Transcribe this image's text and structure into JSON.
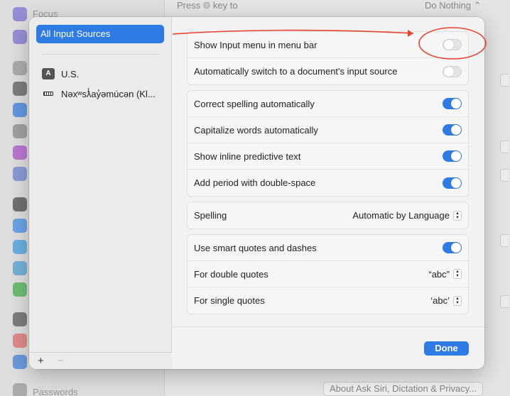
{
  "background": {
    "sidebar_top_label": "Focus",
    "sidebar_bottom_label": "Passwords",
    "press_key_text": "Press",
    "press_key_suffix": "key to",
    "do_nothing_value": "Do Nothing",
    "about_button_label": "About Ask Siri, Dictation & Privacy..."
  },
  "sheet": {
    "sidebar": {
      "selected_label": "All Input Sources",
      "sources": [
        {
          "label": "U.S.",
          "badge": "A",
          "icon": "letter-a-icon"
        },
        {
          "label": "Nəxʷsƛ̓ay̓əmúcən (Kl...",
          "icon": "keyboard-icon"
        }
      ],
      "add_label": "+",
      "remove_label": "−"
    },
    "group1": [
      {
        "label": "Show Input menu in menu bar",
        "on": false
      },
      {
        "label": "Automatically switch to a document's input source",
        "on": false
      }
    ],
    "group2": [
      {
        "label": "Correct spelling automatically",
        "on": true
      },
      {
        "label": "Capitalize words automatically",
        "on": true
      },
      {
        "label": "Show inline predictive text",
        "on": true
      },
      {
        "label": "Add period with double-space",
        "on": true
      }
    ],
    "spelling": {
      "label": "Spelling",
      "value": "Automatic by Language"
    },
    "group4": {
      "smart_quotes_label": "Use smart quotes and dashes",
      "smart_quotes_on": true,
      "double_label": "For double quotes",
      "double_value": "“abc”",
      "single_label": "For single quotes",
      "single_value": "‘abc’"
    },
    "done_label": "Done"
  },
  "colors": {
    "accent": "#2f7be6",
    "annotation": "#e8432f"
  }
}
